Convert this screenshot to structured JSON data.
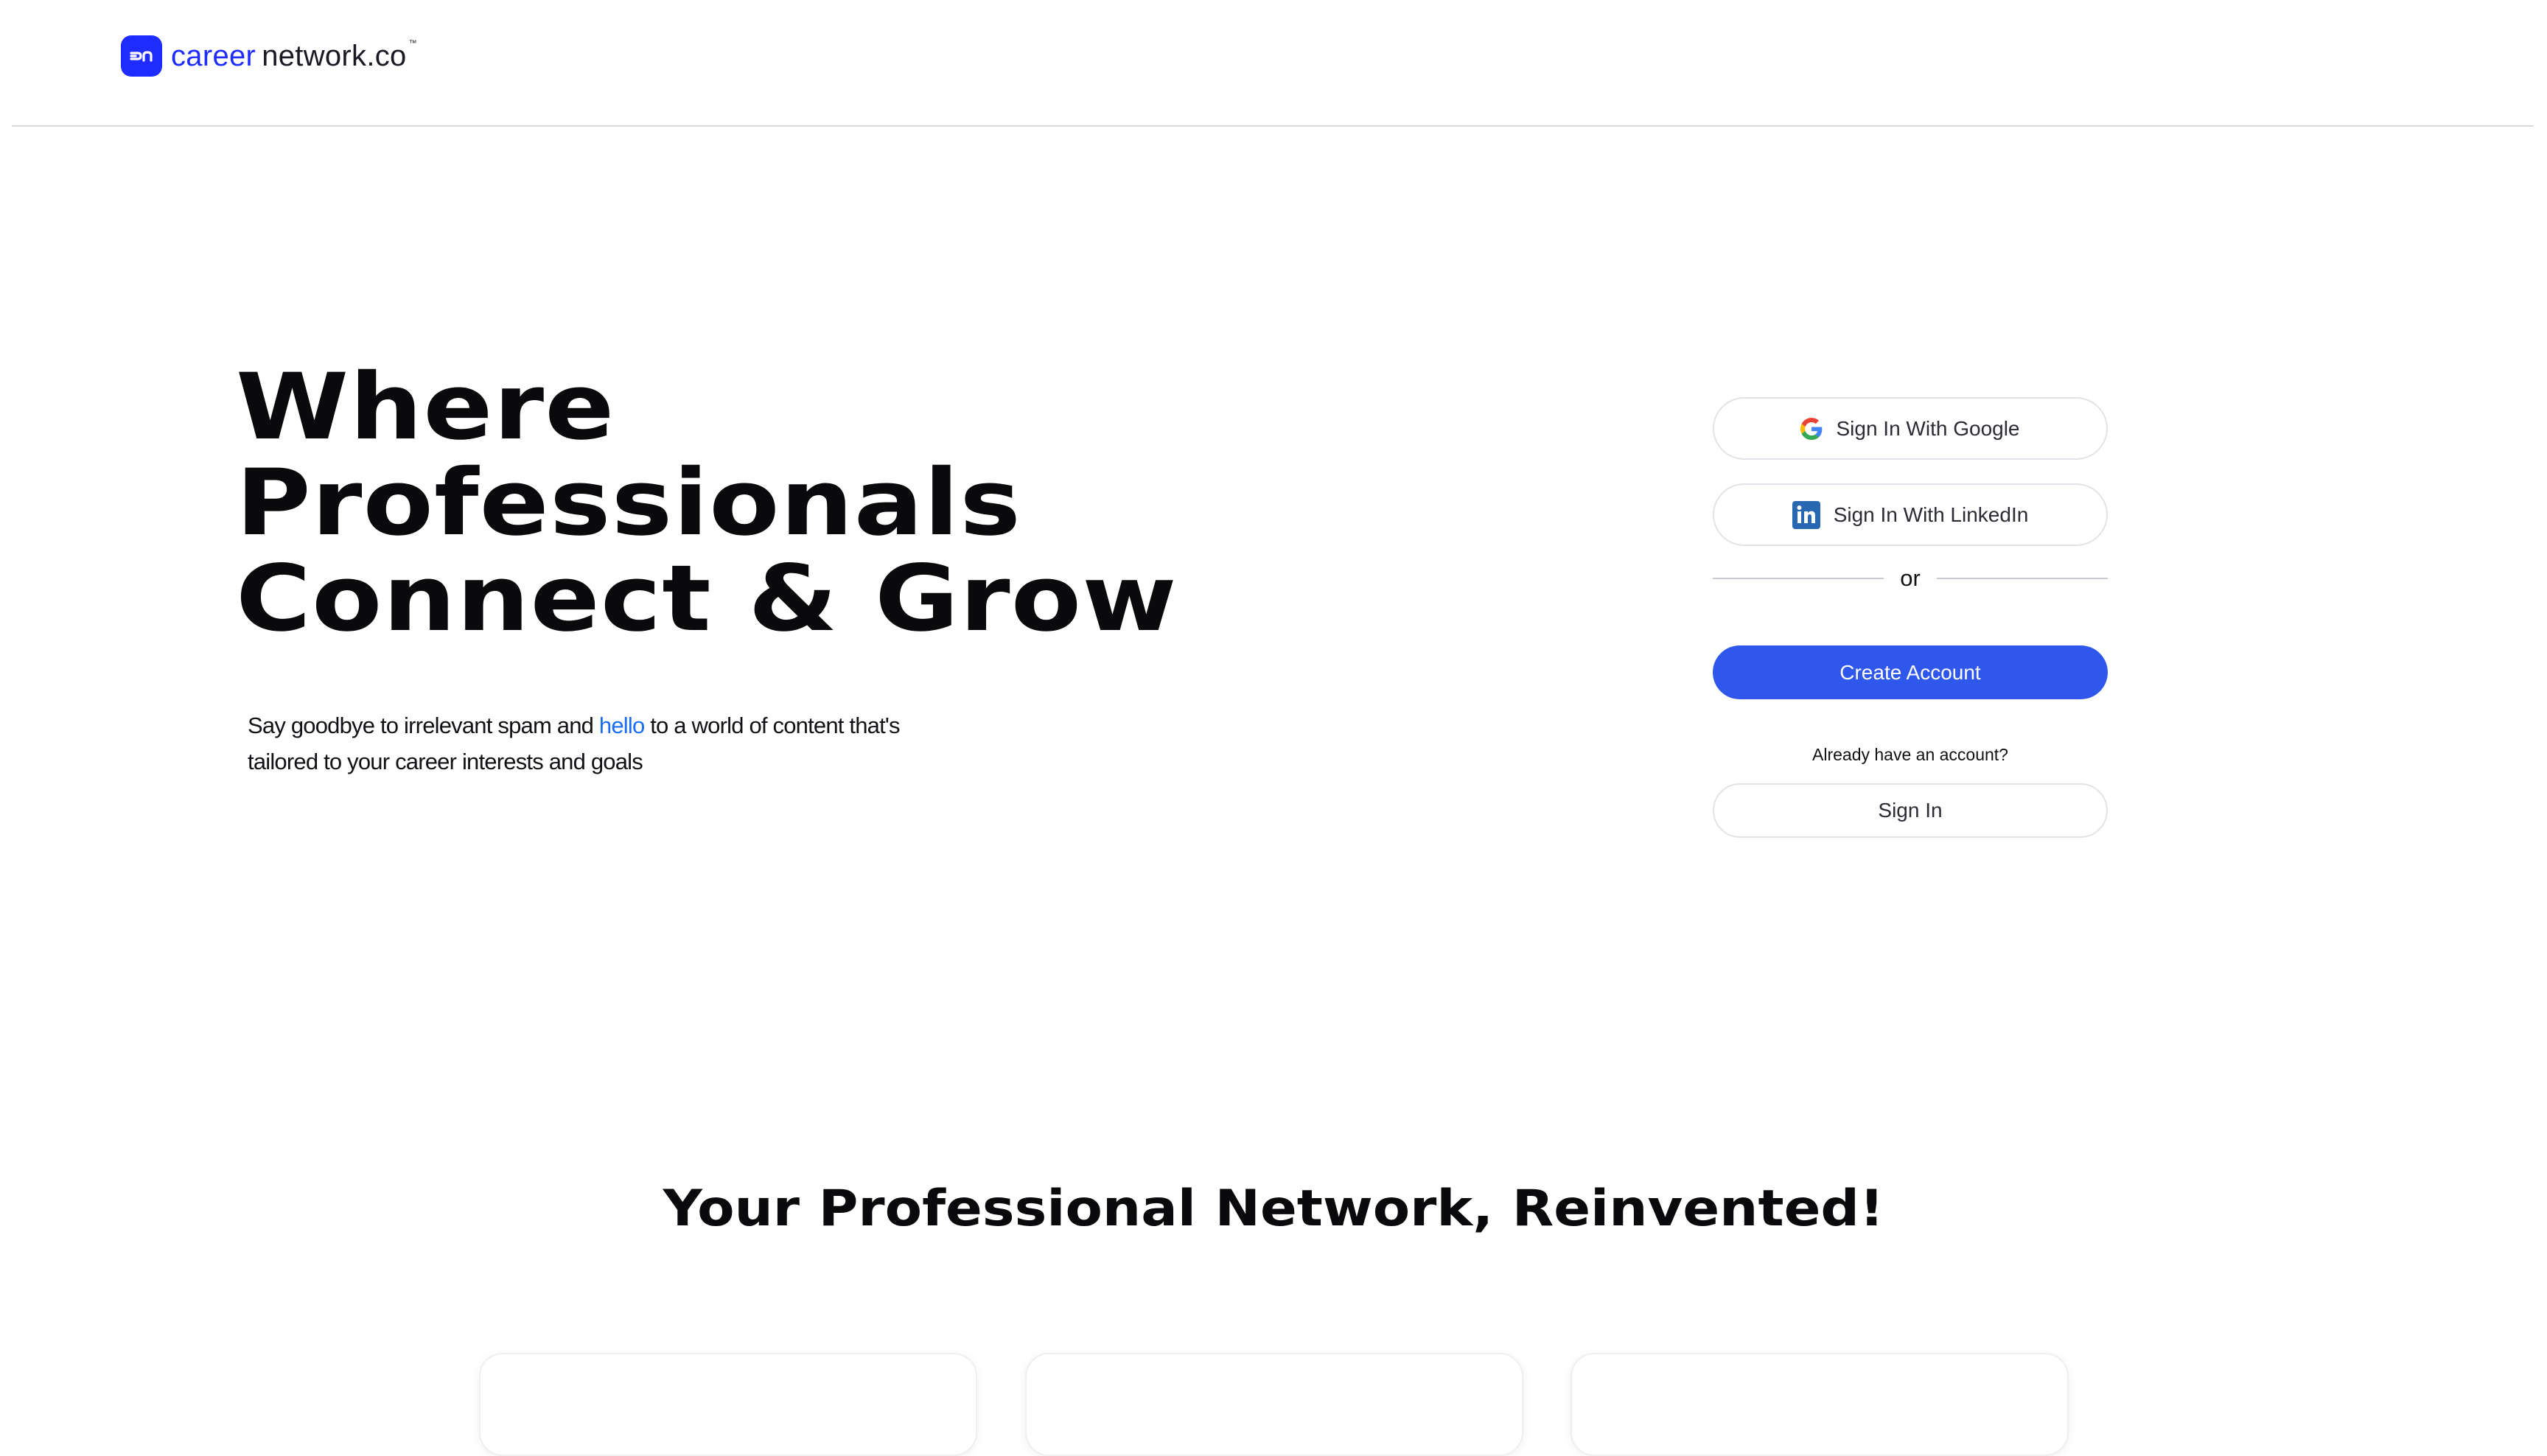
{
  "header": {
    "logo": {
      "career": "career",
      "network": "network.co",
      "tm": "™",
      "icon": "careernetwork-logo-icon"
    }
  },
  "hero": {
    "title_lines": [
      "Where",
      "Professionals",
      "Connect & Grow"
    ],
    "subtitle_before": "Say goodbye to irrelevant spam and ",
    "subtitle_highlight": "hello",
    "subtitle_after": " to a world of content that's tailored to your career interests and goals"
  },
  "auth": {
    "google_label": "Sign In With Google",
    "linkedin_label": "Sign In With LinkedIn",
    "or_label": "or",
    "create_account_label": "Create Account",
    "already_label": "Already have an account?",
    "sign_in_label": "Sign In"
  },
  "section": {
    "title": "Your Professional Network, Reinvented!"
  },
  "colors": {
    "brand": "#1f2cff",
    "primary_button": "#2f57ec",
    "highlight": "#1b6ef3",
    "linkedin": "#2867b2"
  }
}
